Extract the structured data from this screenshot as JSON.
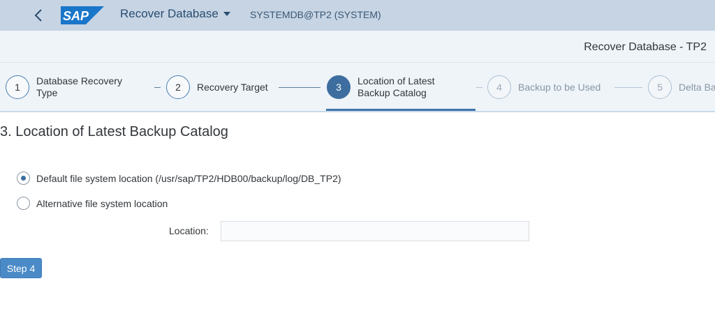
{
  "shell": {
    "app_title": "Recover Database",
    "system_info": "SYSTEMDB@TP2 (SYSTEM)",
    "logo_text": "SAP",
    "logo_color": "#1a76c9"
  },
  "subheader": {
    "page_title": "Recover Database - TP2"
  },
  "wizard": {
    "steps": [
      {
        "number": "1",
        "label_line1": "Database Recovery",
        "label_line2": "Type",
        "state": "done"
      },
      {
        "number": "2",
        "label_line1": "Recovery Target",
        "label_line2": "",
        "state": "done"
      },
      {
        "number": "3",
        "label_line1": "Location of Latest",
        "label_line2": "Backup Catalog",
        "state": "current"
      },
      {
        "number": "4",
        "label_line1": "Backup to be Used",
        "label_line2": "",
        "state": "future"
      },
      {
        "number": "5",
        "label_line1": "Delta Ba",
        "label_line2": "",
        "state": "future"
      }
    ]
  },
  "content": {
    "section_title": "3. Location of Latest Backup Catalog",
    "radio_default_label": "Default file system location (/usr/sap/TP2/HDB00/backup/log/DB_TP2)",
    "radio_default_selected": true,
    "radio_alternative_label": "Alternative file system location",
    "radio_alternative_selected": false,
    "location_label": "Location:",
    "location_value": "",
    "step_button_label": "Step 4"
  },
  "icons": {
    "back": "chevron-left-icon",
    "dropdown": "caret-down-icon"
  },
  "colors": {
    "shell_bg": "#c6d4e4",
    "accent": "#3e6e9f",
    "button": "#4a8ac7"
  }
}
